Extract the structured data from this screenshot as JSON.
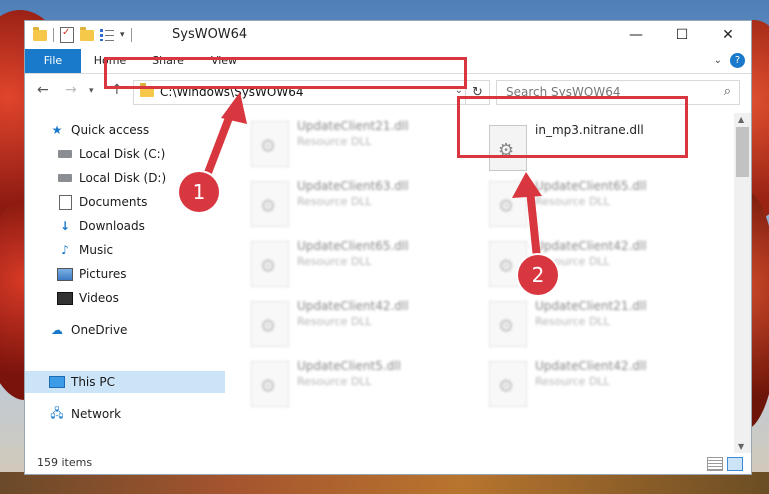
{
  "window": {
    "title": "SysWOW64"
  },
  "ribbon": {
    "tabs": [
      "File",
      "Home",
      "Share",
      "View"
    ]
  },
  "navigation": {
    "address": "C:\\Windows\\SysWOW64",
    "search_placeholder": "Search SysWOW64"
  },
  "sidebar": {
    "items": [
      {
        "label": "Quick access",
        "icon": "star-icon"
      },
      {
        "label": "Local Disk (C:)",
        "icon": "drive-icon"
      },
      {
        "label": "Local Disk (D:)",
        "icon": "drive-icon"
      },
      {
        "label": "Documents",
        "icon": "document-icon"
      },
      {
        "label": "Downloads",
        "icon": "download-icon"
      },
      {
        "label": "Music",
        "icon": "music-icon"
      },
      {
        "label": "Pictures",
        "icon": "pictures-icon"
      },
      {
        "label": "Videos",
        "icon": "videos-icon"
      },
      {
        "label": "OneDrive",
        "icon": "cloud-icon"
      },
      {
        "label": "This PC",
        "icon": "computer-icon",
        "selected": true
      },
      {
        "label": "Network",
        "icon": "network-icon"
      }
    ]
  },
  "files": [
    {
      "name": "UpdateClient21.dll",
      "type": "Resource DLL"
    },
    {
      "name": "in_mp3.nitrane.dll",
      "type": ""
    },
    {
      "name": "UpdateClient63.dll",
      "type": "Resource DLL"
    },
    {
      "name": "UpdateClient65.dll",
      "type": "Resource DLL"
    },
    {
      "name": "UpdateClient65.dll",
      "type": "Resource DLL"
    },
    {
      "name": "UpdateClient42.dll",
      "type": "Resource DLL"
    },
    {
      "name": "UpdateClient42.dll",
      "type": "Resource DLL"
    },
    {
      "name": "UpdateClient21.dll",
      "type": "Resource DLL"
    },
    {
      "name": "UpdateClient5.dll",
      "type": "Resource DLL"
    },
    {
      "name": "UpdateClient42.dll",
      "type": "Resource DLL"
    }
  ],
  "status": {
    "item_count": "159 items"
  },
  "annotations": {
    "step1": "1",
    "step2": "2",
    "highlight_color": "#d9373f"
  },
  "colors": {
    "accent": "#1979ca",
    "selection": "#cce4f7"
  }
}
